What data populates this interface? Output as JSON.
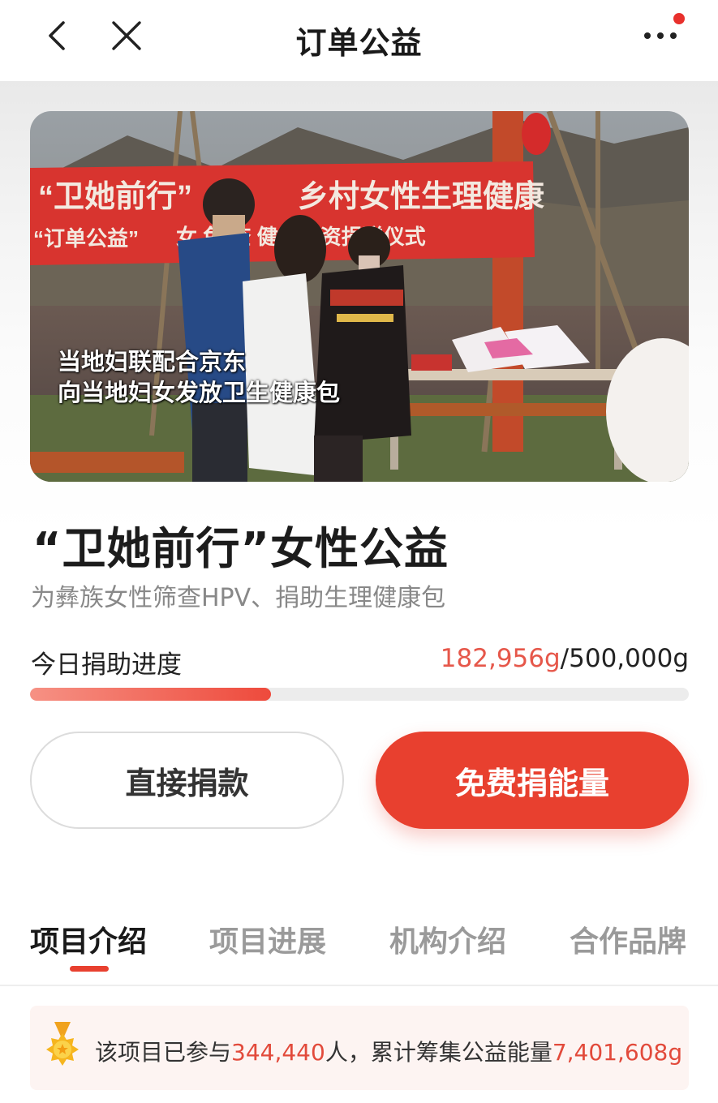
{
  "nav": {
    "title": "订单公益",
    "back_icon": "chevron-left-icon",
    "close_icon": "close-icon",
    "more_icon": "more-dots-icon",
    "notification_dot_color": "#e8302c"
  },
  "hero": {
    "banner_line1": "“卫她前行”",
    "banner_line1_rest": "乡村女性生理健康",
    "banner_line2": "“订单公益”",
    "banner_line2_rest": "女 免 查 健康物资捐赠仪式",
    "caption_line1": "当地妇联配合京东",
    "caption_line2": "向当地妇女发放卫生健康包"
  },
  "project": {
    "title": "“卫她前行”女性公益",
    "subtitle": "为彝族女性筛查HPV、捐助生理健康包"
  },
  "progress": {
    "label": "今日捐助进度",
    "current": "182,956g",
    "separator": "/",
    "target": "500,000g",
    "fraction": 0.366
  },
  "actions": {
    "direct_donate": "直接捐款",
    "free_energy": "免费捐能量"
  },
  "tabs": [
    {
      "label": "项目介绍",
      "active": true
    },
    {
      "label": "项目进展",
      "active": false
    },
    {
      "label": "机构介绍",
      "active": false
    },
    {
      "label": "合作品牌",
      "active": false
    }
  ],
  "stats": {
    "medal_icon": "medal-icon",
    "prefix": "该项目已参与",
    "participants": "344,440",
    "middle": "人，累计筹集公益能量",
    "energy": "7,401,608g"
  },
  "colors": {
    "accent": "#e8402f",
    "accent_text": "#e6574a",
    "stats_bg": "#fdf4f2"
  }
}
